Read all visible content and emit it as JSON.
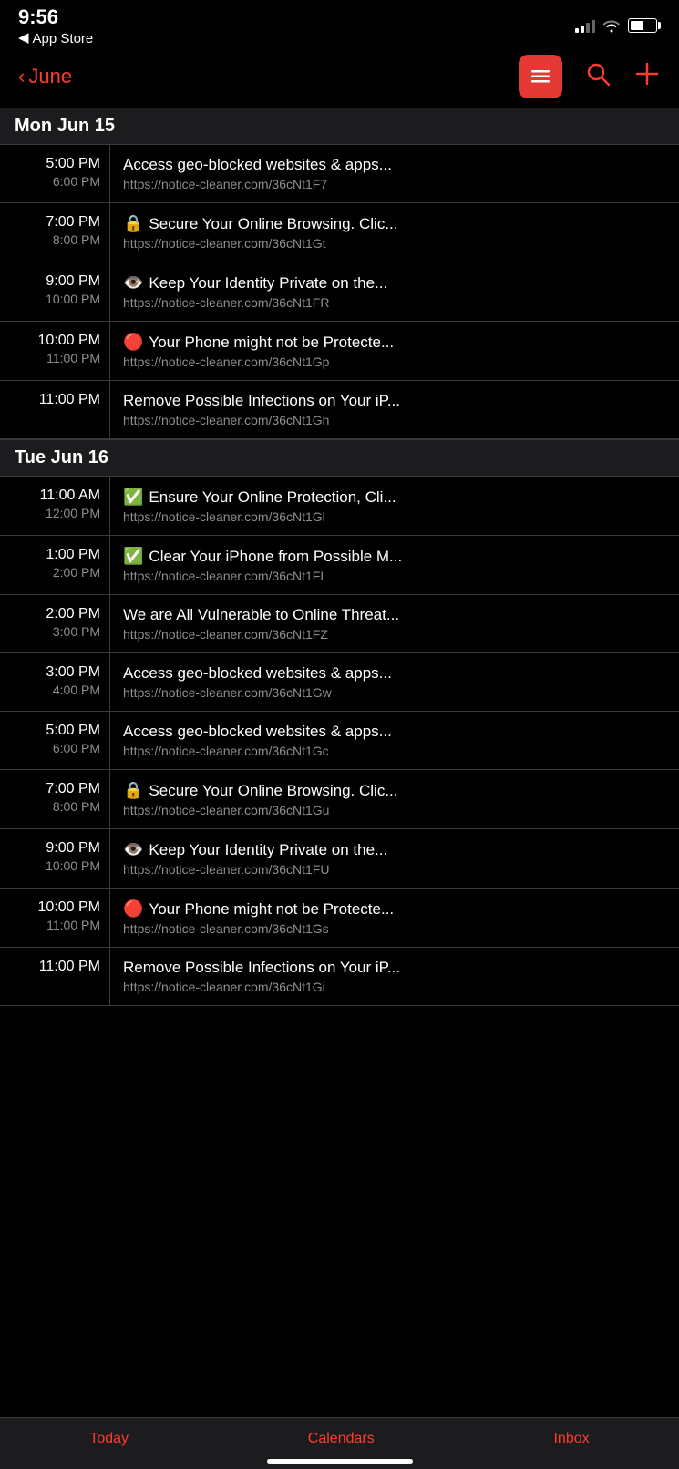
{
  "statusBar": {
    "time": "9:56",
    "backApp": "App Store"
  },
  "nav": {
    "backLabel": "June",
    "listIconAlt": "list-icon",
    "searchIconAlt": "search-icon",
    "addIconAlt": "add-icon"
  },
  "days": [
    {
      "label": "Mon  Jun 15",
      "events": [
        {
          "startTime": "5:00 PM",
          "endTime": "6:00 PM",
          "icon": "",
          "title": "Access geo-blocked websites & apps...",
          "url": "https://notice-cleaner.com/36cNt1F7"
        },
        {
          "startTime": "7:00 PM",
          "endTime": "8:00 PM",
          "icon": "🔒",
          "title": "Secure Your Online Browsing. Clic...",
          "url": "https://notice-cleaner.com/36cNt1Gt"
        },
        {
          "startTime": "9:00 PM",
          "endTime": "10:00 PM",
          "icon": "👁️",
          "title": "Keep Your Identity Private on the...",
          "url": "https://notice-cleaner.com/36cNt1FR"
        },
        {
          "startTime": "10:00 PM",
          "endTime": "11:00 PM",
          "icon": "🔴",
          "title": "Your Phone might not be Protecte...",
          "url": "https://notice-cleaner.com/36cNt1Gp"
        },
        {
          "startTime": "11:00 PM",
          "endTime": "",
          "icon": "",
          "title": "Remove Possible Infections on Your iP...",
          "url": "https://notice-cleaner.com/36cNt1Gh"
        }
      ]
    },
    {
      "label": "Tue  Jun 16",
      "events": [
        {
          "startTime": "11:00 AM",
          "endTime": "12:00 PM",
          "icon": "✅",
          "title": "Ensure Your Online Protection, Cli...",
          "url": "https://notice-cleaner.com/36cNt1Gl"
        },
        {
          "startTime": "1:00 PM",
          "endTime": "2:00 PM",
          "icon": "✅",
          "title": "Clear Your iPhone from Possible M...",
          "url": "https://notice-cleaner.com/36cNt1FL"
        },
        {
          "startTime": "2:00 PM",
          "endTime": "3:00 PM",
          "icon": "",
          "title": "We are All Vulnerable to Online Threat...",
          "url": "https://notice-cleaner.com/36cNt1FZ"
        },
        {
          "startTime": "3:00 PM",
          "endTime": "4:00 PM",
          "icon": "",
          "title": "Access geo-blocked websites & apps...",
          "url": "https://notice-cleaner.com/36cNt1Gw"
        },
        {
          "startTime": "5:00 PM",
          "endTime": "6:00 PM",
          "icon": "",
          "title": "Access geo-blocked websites & apps...",
          "url": "https://notice-cleaner.com/36cNt1Gc"
        },
        {
          "startTime": "7:00 PM",
          "endTime": "8:00 PM",
          "icon": "🔒",
          "title": "Secure Your Online Browsing. Clic...",
          "url": "https://notice-cleaner.com/36cNt1Gu"
        },
        {
          "startTime": "9:00 PM",
          "endTime": "10:00 PM",
          "icon": "👁️",
          "title": "Keep Your Identity Private on the...",
          "url": "https://notice-cleaner.com/36cNt1FU"
        },
        {
          "startTime": "10:00 PM",
          "endTime": "11:00 PM",
          "icon": "🔴",
          "title": "Your Phone might not be Protecte...",
          "url": "https://notice-cleaner.com/36cNt1Gs"
        },
        {
          "startTime": "11:00 PM",
          "endTime": "",
          "icon": "",
          "title": "Remove Possible Infections on Your iP...",
          "url": "https://notice-cleaner.com/36cNt1Gi"
        }
      ]
    }
  ],
  "tabBar": {
    "tabs": [
      {
        "id": "today",
        "label": "Today"
      },
      {
        "id": "calendars",
        "label": "Calendars"
      },
      {
        "id": "inbox",
        "label": "Inbox"
      }
    ]
  }
}
